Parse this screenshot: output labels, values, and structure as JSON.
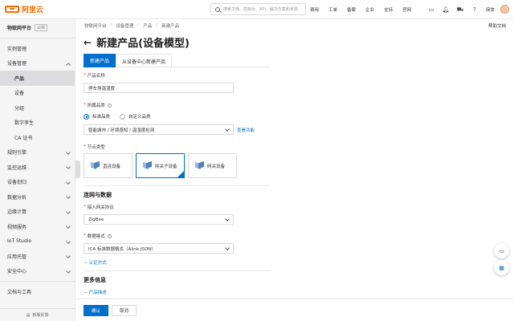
{
  "topbar": {
    "logo_text": "阿里云",
    "search_placeholder": "搜索文档、控制台、API、解决方案和资源",
    "nav": [
      "费用",
      "工单",
      "备案",
      "企业",
      "支持",
      "官网"
    ],
    "lang": "简体",
    "icons": [
      "terminal-icon",
      "bell-icon",
      "cart-icon",
      "help-icon"
    ]
  },
  "sidebar": {
    "platform": "物联网平台",
    "platform_tag": "公共",
    "items": [
      {
        "label": "实例管理",
        "level": 0
      },
      {
        "label": "设备管理",
        "level": 0,
        "expanded": true
      },
      {
        "label": "产品",
        "level": 1,
        "active": true
      },
      {
        "label": "设备",
        "level": 1
      },
      {
        "label": "分组",
        "level": 1
      },
      {
        "label": "数字孪生",
        "level": 1
      },
      {
        "label": "CA 证书",
        "level": 1
      },
      {
        "label": "规则引擎",
        "level": 0,
        "collapsed": true
      },
      {
        "label": "监控运维",
        "level": 0,
        "collapsed": true
      },
      {
        "label": "设备划归",
        "level": 0,
        "collapsed": true
      },
      {
        "label": "数据分析",
        "level": 0,
        "collapsed": true
      },
      {
        "label": "边缘计算",
        "level": 0,
        "collapsed": true
      },
      {
        "label": "视频服务",
        "level": 0,
        "collapsed": true
      },
      {
        "label": "IoT Studio",
        "level": 0,
        "collapsed": true
      },
      {
        "label": "应用托管",
        "level": 0,
        "collapsed": true
      },
      {
        "label": "安全中心",
        "level": 0,
        "collapsed": true
      },
      {
        "label": "文档与工具",
        "level": 0
      }
    ],
    "feedback": "新版反馈"
  },
  "breadcrumb": [
    "物联网平台",
    "设备管理",
    "产品",
    "新建产品"
  ],
  "help_doc": "帮助文档",
  "title": "新建产品(设备模型)",
  "tabs": [
    "新建产品",
    "从设备中心新建产品"
  ],
  "form": {
    "product_name_label": "产品名称",
    "product_name_value": "停车场温湿度",
    "category_label": "所属品类",
    "category_options": [
      "标准品类",
      "自定义品类"
    ],
    "category_value": "智能城市 / 环境感知 / 温湿度检测",
    "view_function": "查看功能",
    "node_type_label": "节点类型",
    "node_types": [
      "直连设备",
      "网关子设备",
      "网关设备"
    ],
    "connectivity_title": "连网与数据",
    "gateway_protocol_label": "接入网关协议",
    "gateway_protocol_value": "ZigBee",
    "data_format_label": "数据格式",
    "data_format_value": "ICA 标准数据格式（Alink JSON）",
    "auth_link": "认证方式",
    "more_title": "更多信息",
    "desc_link": "产品描述"
  },
  "footer": {
    "confirm": "确认",
    "cancel": "取消"
  },
  "colors": {
    "brand": "#ff6a00",
    "primary": "#0070cc"
  }
}
